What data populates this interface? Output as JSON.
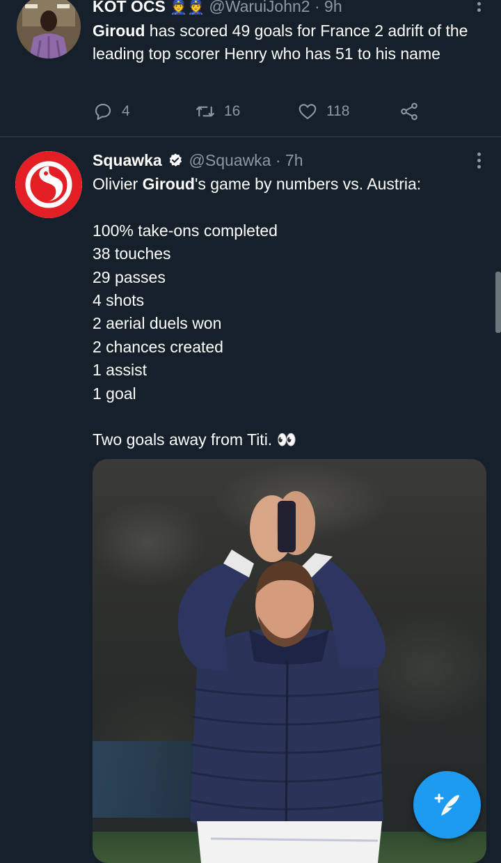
{
  "tweets": [
    {
      "name": "KOT OCS",
      "name_emoji": "👮👮",
      "handle": "@WaruiJohn2",
      "time": "· 9h",
      "text_bold": "Giroud",
      "text_rest": " has scored 49 goals for France 2 adrift of the leading top scorer Henry who has 51 to his name",
      "replies": "4",
      "retweets": "16",
      "likes": "118"
    },
    {
      "name": "Squawka",
      "handle": "@Squawka",
      "time": "· 7h",
      "intro_pre": "Olivier ",
      "intro_bold": "Giroud",
      "intro_post": "'s game by numbers vs. Austria:",
      "stats": [
        "100% take-ons completed",
        "38 touches",
        "29 passes",
        "4 shots",
        "2 aerial duels won",
        "2 chances created",
        "1 assist",
        "1 goal"
      ],
      "closing": "Two goals away from Titi. 👀"
    }
  ],
  "colors": {
    "background": "#15202b",
    "accent": "#1d9bf0",
    "muted": "#8b98a5",
    "squawka_red": "#e31e24"
  },
  "icons": {
    "reply": "reply-icon",
    "retweet": "retweet-icon",
    "like": "heart-icon",
    "share": "share-icon",
    "more": "more-icon",
    "verified": "verified-badge-icon",
    "compose": "compose-tweet-icon"
  }
}
